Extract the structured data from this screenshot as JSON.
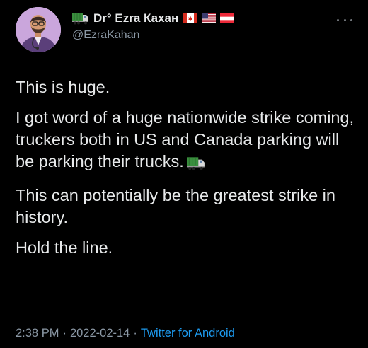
{
  "author": {
    "display_name": "Dr° Ezra Кахан",
    "handle": "@EzraKahan",
    "emoji_prefix": "truck-emoji-icon",
    "flags": [
      "canada-flag-icon",
      "usa-flag-icon",
      "austria-flag-icon"
    ]
  },
  "tweet": {
    "paragraphs": [
      "This is huge.",
      "I got word of a huge nationwide strike coming, truckers both in US and Canada parking will be parking their trucks.",
      "This can potentially be the greatest strike in history.",
      "Hold the line."
    ],
    "inline_emoji_after_paragraph": 1
  },
  "meta": {
    "time": "2:38 PM",
    "separator": "·",
    "date": "2022-02-14",
    "source": "Twitter for Android"
  },
  "colors": {
    "background": "#000000",
    "text": "#e7e9ea",
    "secondary": "#8b98a5",
    "link": "#1d9bf0"
  }
}
